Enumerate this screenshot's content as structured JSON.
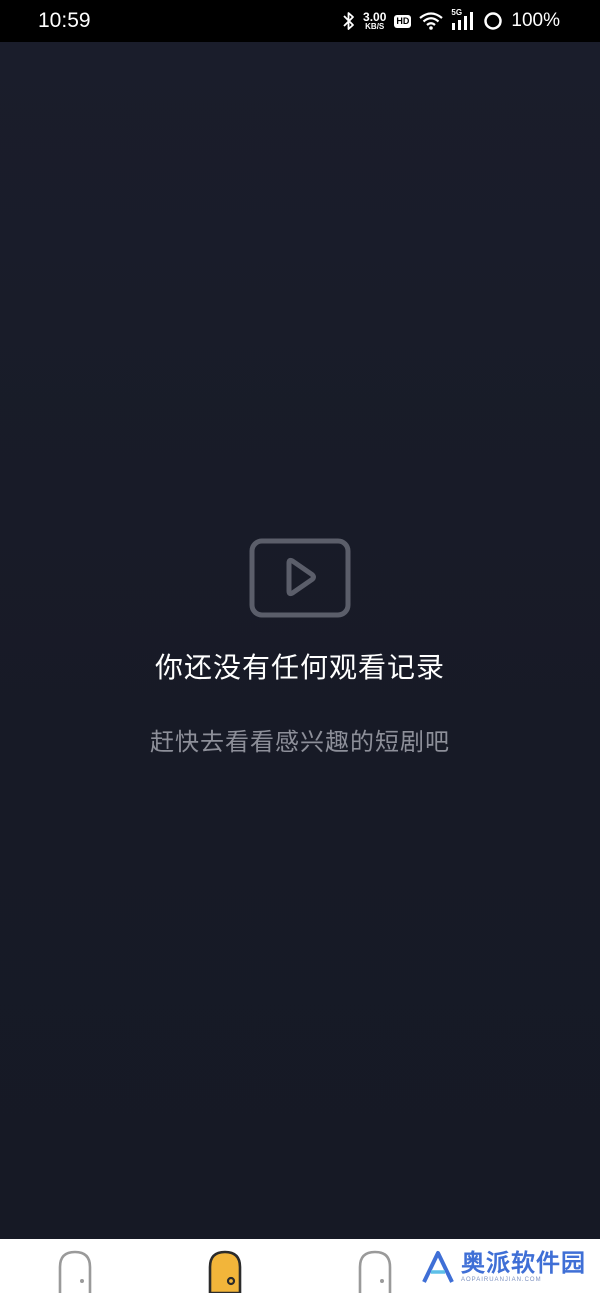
{
  "status_bar": {
    "time": "10:59",
    "net_speed_value": "3.00",
    "net_speed_unit": "KB/S",
    "hd": "HD",
    "network": "5G",
    "battery": "100%"
  },
  "empty_state": {
    "icon": "play-video-icon",
    "title": "你还没有任何观看记录",
    "subtitle": "赶快去看看感兴趣的短剧吧"
  },
  "bottom_nav": {
    "tabs": [
      {
        "icon": "theater-icon",
        "active": false
      },
      {
        "icon": "theater-icon",
        "active": true
      },
      {
        "icon": "theater-icon",
        "active": false
      }
    ],
    "active_color": "#f2b53a",
    "inactive_color": "#999999"
  },
  "watermark": {
    "text": "奥派软件园",
    "url": "AOPAIRUANJIAN.COM",
    "color": "#3f6fd6"
  }
}
